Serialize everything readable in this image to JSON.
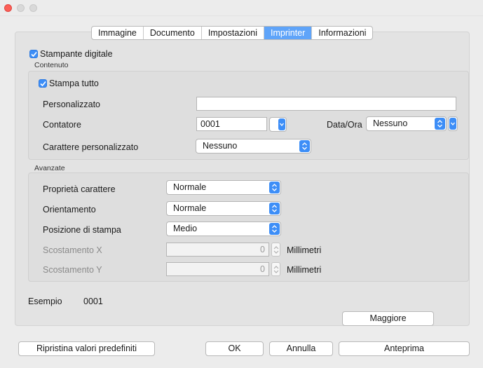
{
  "tabs": [
    "Immagine",
    "Documento",
    "Impostazioni",
    "Imprinter",
    "Informazioni"
  ],
  "active_tab_index": 3,
  "digital_printer": {
    "label": "Stampante digitale",
    "checked": true
  },
  "content_group": {
    "title": "Contenuto",
    "print_all": {
      "label": "Stampa tutto",
      "checked": true
    },
    "custom_label": "Personalizzato",
    "custom_value": "",
    "counter_label": "Contatore",
    "counter_value": "0001",
    "datetime_label": "Data/Ora",
    "datetime_value": "Nessuno",
    "custom_char_label": "Carattere personalizzato",
    "custom_char_value": "Nessuno"
  },
  "advanced_group": {
    "title": "Avanzate",
    "char_props_label": "Proprietà carattere",
    "char_props_value": "Normale",
    "orientation_label": "Orientamento",
    "orientation_value": "Normale",
    "print_pos_label": "Posizione di stampa",
    "print_pos_value": "Medio",
    "offset_x_label": "Scostamento X",
    "offset_x_value": "0",
    "offset_x_unit": "Millimetri",
    "offset_y_label": "Scostamento Y",
    "offset_y_value": "0",
    "offset_y_unit": "Millimetri"
  },
  "example_label": "Esempio",
  "example_value": "0001",
  "more_button": "Maggiore",
  "buttons": {
    "restore": "Ripristina valori predefiniti",
    "ok": "OK",
    "cancel": "Annulla",
    "preview": "Anteprima"
  },
  "colors": {
    "accent": "#3d8ef7",
    "active_tab": "#5fa4f9",
    "close": "#fc5f57"
  }
}
